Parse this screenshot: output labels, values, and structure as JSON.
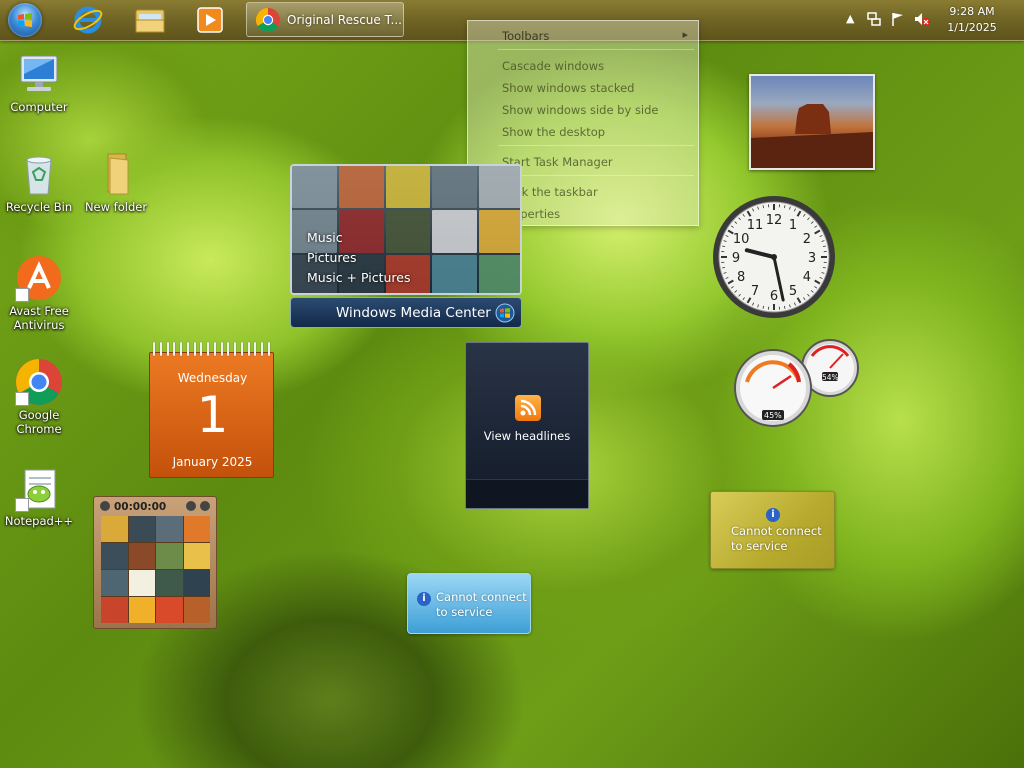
{
  "taskbar": {
    "pinned": [
      "internet-explorer",
      "windows-explorer",
      "windows-media-player"
    ],
    "active_task": {
      "label": "Original Rescue T...",
      "icon": "chrome-icon"
    },
    "clock": {
      "time": "9:28 AM",
      "date": "1/1/2025"
    }
  },
  "context_menu": {
    "items": [
      "Toolbars",
      "Cascade windows",
      "Show windows stacked",
      "Show windows side by side",
      "Show the desktop",
      "Start Task Manager",
      "Lock the taskbar",
      "Properties"
    ],
    "submenu_arrow": "▸"
  },
  "desktop_icons": [
    {
      "label": "Computer"
    },
    {
      "label": "Recycle Bin"
    },
    {
      "label": "New folder"
    },
    {
      "label": "Avast Free Antivirus"
    },
    {
      "label": "Google Chrome"
    },
    {
      "label": "Notepad++"
    }
  ],
  "gadgets": {
    "media_center": {
      "menu": [
        "Music",
        "Pictures",
        "Music + Pictures"
      ],
      "brand": "Windows Media Center"
    },
    "calendar": {
      "weekday": "Wednesday",
      "day": "1",
      "month_year": "January 2025"
    },
    "feed": {
      "label": "View headlines"
    },
    "clock": {
      "hour": 9,
      "minute": 28,
      "numerals": [
        "12",
        "1",
        "2",
        "3",
        "4",
        "5",
        "6",
        "7",
        "8",
        "9",
        "10",
        "11"
      ]
    },
    "cpu_meter": {
      "cpu_percent": "45%",
      "memory_percent": "54%"
    },
    "puzzle": {
      "timer": "00:00:00"
    },
    "weather": {
      "message_line1": "Cannot connect",
      "message_line2": "to service"
    },
    "currency": {
      "message_line1": "Cannot connect",
      "message_line2": "to service"
    }
  },
  "colors": {
    "taskbar": "#6f6424",
    "calendar": "#e06a1a",
    "weather": "#5fb6e6",
    "currency": "#c9bd47"
  }
}
